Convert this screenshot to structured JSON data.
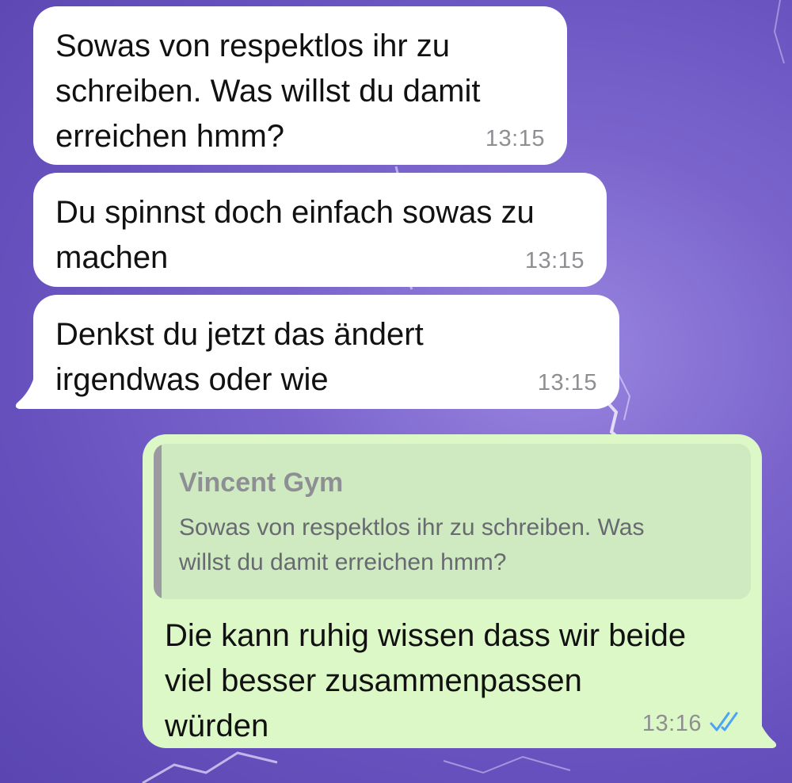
{
  "colors": {
    "incoming_bubble": "#ffffff",
    "outgoing_bubble": "#dcf8c6",
    "quote_background": "#cfeac0",
    "timestamp": "#8e8e93",
    "read_ticks": "#4fa3f7",
    "wallpaper": "#6f5ac6"
  },
  "messages": [
    {
      "direction": "incoming",
      "text": "Sowas von respektlos ihr zu\nschreiben. Was willst du damit\nerreichen hmm?",
      "time": "13:15"
    },
    {
      "direction": "incoming",
      "text": "Du spinnst doch einfach sowas zu\nmachen",
      "time": "13:15"
    },
    {
      "direction": "incoming",
      "text": "Denkst du jetzt das ändert\nirgendwas oder wie",
      "time": "13:15"
    },
    {
      "direction": "outgoing",
      "reply": {
        "author": "Vincent Gym",
        "text": "Sowas von respektlos ihr zu schreiben. Was\nwillst du damit erreichen hmm?"
      },
      "text": "Die kann ruhig wissen dass wir beide\nviel besser zusammenpassen\nwürden",
      "time": "13:16",
      "status_icon": "double-check-read-icon"
    }
  ]
}
